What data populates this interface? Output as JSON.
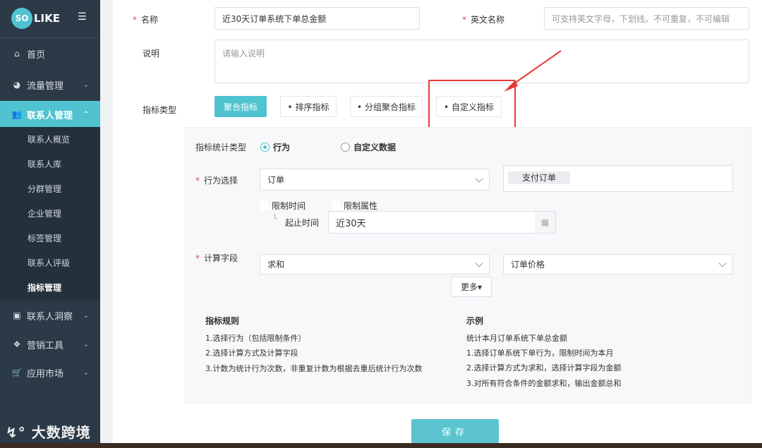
{
  "sidebar": {
    "logo_badge": "SO",
    "logo_text": "LIKE",
    "menu_toggle": "☰",
    "items": {
      "home": {
        "label": "首页"
      },
      "traffic": {
        "label": "流量管理"
      },
      "contacts": {
        "label": "联系人管理"
      },
      "insight": {
        "label": "联系人洞察"
      },
      "marketing": {
        "label": "营销工具"
      },
      "apps": {
        "label": "应用市场"
      }
    },
    "sub_items": [
      "联系人概览",
      "联系人库",
      "分群管理",
      "企业管理",
      "标签管理",
      "联系人评级",
      "指标管理"
    ],
    "watermark": "大数跨境"
  },
  "form": {
    "name_label": "名称",
    "name_value": "近30天订单系统下单总金额",
    "en_name_label": "英文名称",
    "en_name_placeholder": "可支持英文字母，下划线。不可重复，不可编辑",
    "desc_label": "说明",
    "desc_placeholder": "请输入说明",
    "type_label": "指标类型",
    "tabs": [
      "聚合指标",
      "• 排序指标",
      "• 分组聚合指标",
      "• 自定义指标"
    ]
  },
  "panel": {
    "stat_type_label": "指标统计类型",
    "radio_behavior": "行为",
    "radio_custom": "自定义数据",
    "behavior_label": "行为选择",
    "behavior_value": "订单",
    "behavior_tag": "支付订单",
    "limit_time": "限制时间",
    "limit_attr": "限制属性",
    "range_label": "起止时间",
    "range_value": "近30天",
    "calc_label": "计算字段",
    "calc_value": "求和",
    "calc_field_value": "订单价格",
    "more": "更多▾",
    "rules_title": "指标规则",
    "rules": [
      "1.选择行为（包括限制条件）",
      "2.选择计算方式及计算字段",
      "3.计数为统计行为次数，非重复计数为根据去重后统计行为次数"
    ],
    "example_title": "示例",
    "examples": [
      "统计本月订单系统下单总金额",
      "1.选择订单系统下单行为，限制时间为本月",
      "2.选择计算方式为求和，选择计算字段为金额",
      "3.对所有符合条件的金额求和，输出金额总和"
    ]
  },
  "save_label": "保存",
  "colors": {
    "accent": "#4fc3d0",
    "sidebar_bg": "#2c3a47",
    "highlight_box": "#e53935"
  }
}
